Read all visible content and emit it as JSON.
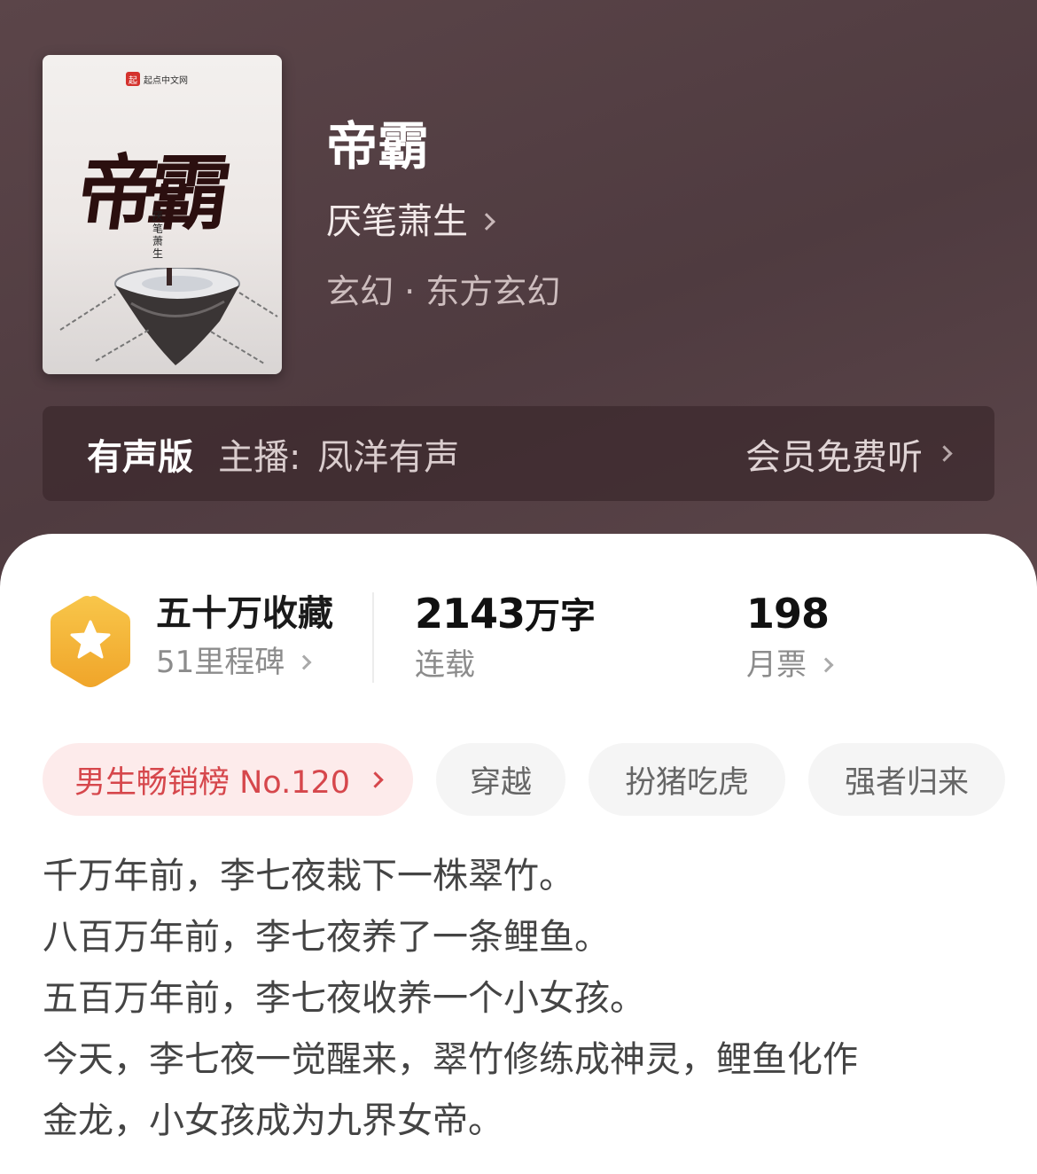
{
  "book": {
    "title": "帝霸",
    "author": "厌笔萧生",
    "genre": "玄幻 · 东方玄幻",
    "cover": {
      "publisher_logo": "起点中文网",
      "logo_mark": "起",
      "title_art": "帝霸",
      "author_art": "厌笔萧生"
    }
  },
  "audio": {
    "tag": "有声版",
    "host_label": "主播:",
    "host_name": "凤洋有声",
    "action": "会员免费听"
  },
  "stats": {
    "favorites": "五十万收藏",
    "milestone": "51里程碑",
    "word_count": "2143",
    "word_unit": "万字",
    "status": "连载",
    "monthly_votes": "198",
    "monthly_votes_label": "月票"
  },
  "tags": {
    "rank": "男生畅销榜 No.120",
    "items": [
      "穿越",
      "扮猪吃虎",
      "强者归来"
    ]
  },
  "synopsis": [
    "千万年前，李七夜栽下一株翠竹。",
    "八百万年前，李七夜养了一条鲤鱼。",
    "五百万年前，李七夜收养一个小女孩。",
    "今天，李七夜一觉醒来，翠竹修练成神灵，鲤鱼化作",
    "金龙，小女孩成为九界女帝。"
  ],
  "colors": {
    "hero_bg": "#5a4448",
    "badge_orange": "#f5b73b",
    "rank_text": "#d6474c",
    "rank_bg": "#fdebeb"
  },
  "icons": {
    "badge": "star-hexagon-icon",
    "chevron": "chevron-right-icon"
  }
}
